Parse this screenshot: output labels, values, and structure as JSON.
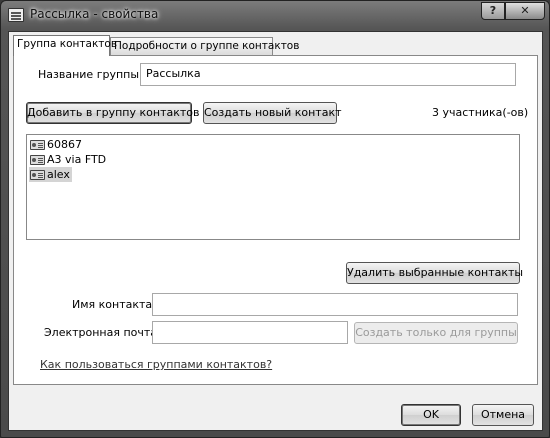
{
  "window": {
    "title": "Рассылка - свойства",
    "help_label": "?",
    "close_label": "✕"
  },
  "tabs": [
    {
      "label": "Группа контактов",
      "active": true
    },
    {
      "label": "Подробности о группе контактов",
      "active": false
    }
  ],
  "group": {
    "name_label": "Название группы:",
    "name_value": "Рассылка"
  },
  "toolbar": {
    "add_label": "Добавить в группу контактов",
    "create_label": "Создать новый контакт",
    "member_count": "3 участника(-ов)"
  },
  "members": [
    {
      "name": "60867",
      "icon": "contact-card-icon"
    },
    {
      "name": "A3 via FTD",
      "icon": "contact-card-icon"
    },
    {
      "name": "alex",
      "icon": "contact-card-icon",
      "selected": true
    }
  ],
  "remove_label": "Удалить выбранные контакты",
  "contact_form": {
    "name_label": "Имя контакта:",
    "name_value": "",
    "email_label": "Электронная почта:",
    "email_value": "",
    "create_for_group_label": "Создать только для группы"
  },
  "help_link": "Как пользоваться группами контактов?",
  "footer": {
    "ok_label": "OK",
    "cancel_label": "Отмена"
  }
}
